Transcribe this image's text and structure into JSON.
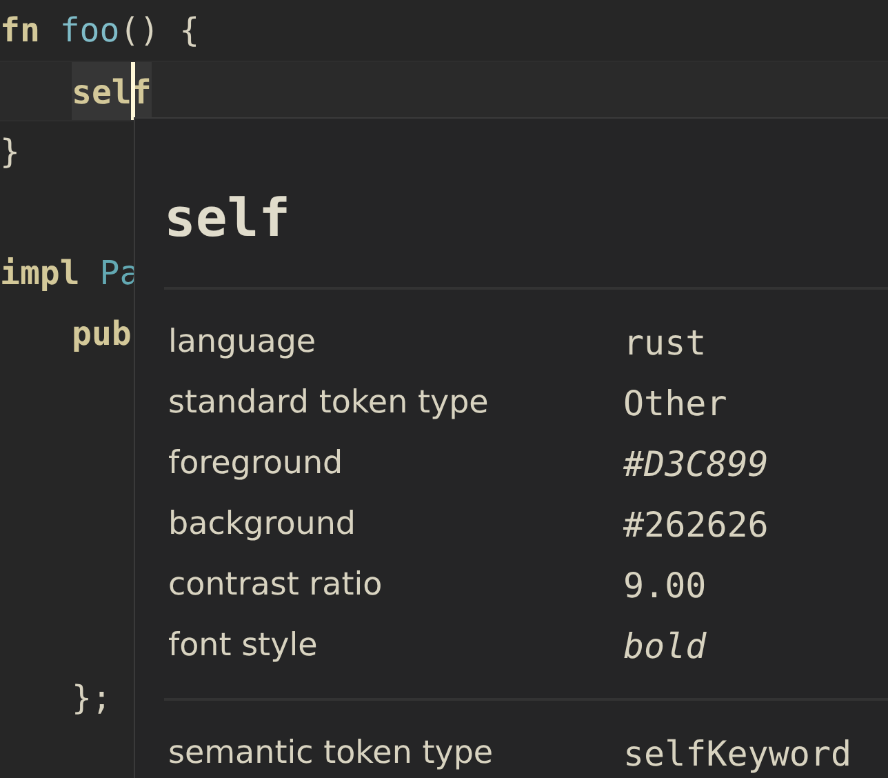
{
  "editor": {
    "lines": [
      {
        "kind": "code",
        "indented": false,
        "current": false,
        "tokens": [
          {
            "text": "fn",
            "kind": "keyword"
          },
          {
            "text": "foo",
            "kind": "function"
          },
          {
            "text": "() {",
            "kind": "punct"
          }
        ]
      },
      {
        "kind": "code",
        "indented": true,
        "current": true,
        "tokens": [
          {
            "text": "self",
            "kind": "keyword"
          }
        ]
      },
      {
        "kind": "code",
        "indented": false,
        "current": false,
        "tokens": [
          {
            "text": "}",
            "kind": "punct"
          }
        ]
      },
      {
        "kind": "blank"
      },
      {
        "kind": "code",
        "indented": false,
        "current": false,
        "tokens": [
          {
            "text": "impl",
            "kind": "keyword"
          },
          {
            "text": "Pa",
            "kind": "type"
          }
        ]
      },
      {
        "kind": "code",
        "indented": true,
        "current": false,
        "tokens": [
          {
            "text": "pub",
            "kind": "keyword"
          }
        ]
      },
      {
        "kind": "blank"
      },
      {
        "kind": "blank"
      },
      {
        "kind": "blank"
      },
      {
        "kind": "blank"
      },
      {
        "kind": "blank"
      },
      {
        "kind": "code",
        "indented": true,
        "current": false,
        "tokens": [
          {
            "text": "};",
            "kind": "punct"
          }
        ]
      }
    ]
  },
  "inspector": {
    "title": "self",
    "rows": [
      {
        "label": "language",
        "value": "rust",
        "italic": false
      },
      {
        "label": "standard token type",
        "value": "Other",
        "italic": false
      },
      {
        "label": "foreground",
        "value": "#D3C899",
        "italic": true
      },
      {
        "label": "background",
        "value": "#262626",
        "italic": false
      },
      {
        "label": "contrast ratio",
        "value": "9.00",
        "italic": false
      },
      {
        "label": "font style",
        "value": "bold",
        "italic": true
      }
    ],
    "semantic_rows": [
      {
        "label": "semantic token type",
        "value": "selfKeyword",
        "italic": false
      }
    ]
  }
}
